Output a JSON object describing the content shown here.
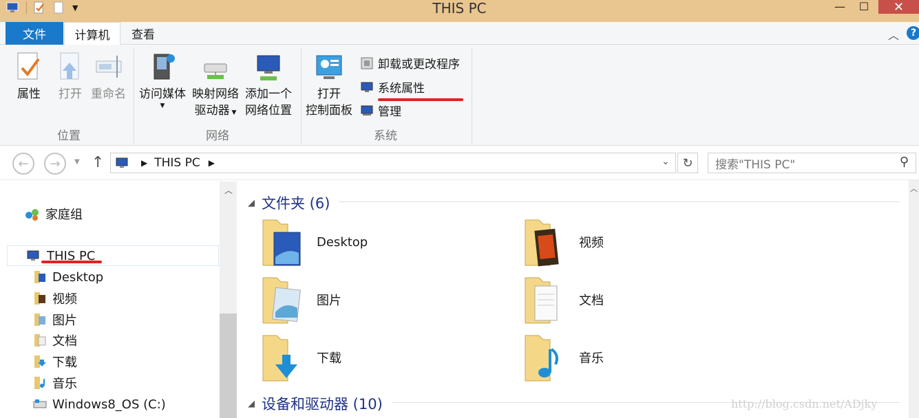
{
  "window": {
    "title": "THIS PC",
    "close_glyph": "✕",
    "maximize_glyph": "☐",
    "minimize_glyph": "—"
  },
  "tabs": [
    {
      "label": "文件"
    },
    {
      "label": "计算机"
    },
    {
      "label": "查看"
    }
  ],
  "ribbon": {
    "location": {
      "group_label": "位置",
      "properties": "属性",
      "open": "打开",
      "rename": "重命名"
    },
    "network": {
      "group_label": "网络",
      "access_media": "访问媒体",
      "map_drive_line1": "映射网络",
      "map_drive_line2": "驱动器",
      "add_location_line1": "添加一个",
      "add_location_line2": "网络位置"
    },
    "system": {
      "group_label": "系统",
      "open_cp_line1": "打开",
      "open_cp_line2": "控制面板",
      "uninstall": "卸载或更改程序",
      "system_properties": "系统属性",
      "manage": "管理"
    }
  },
  "address": {
    "path": "THIS PC",
    "search_placeholder": "搜索\"THIS PC\""
  },
  "nav": {
    "homegroup": "家庭组",
    "this_pc": "THIS PC",
    "items": [
      "Desktop",
      "视频",
      "图片",
      "文档",
      "下载",
      "音乐",
      "Windows8_OS (C:)"
    ]
  },
  "content": {
    "folders_header": "文件夹 (6)",
    "folders": [
      "Desktop",
      "视频",
      "图片",
      "文档",
      "下载",
      "音乐"
    ],
    "devices_header": "设备和驱动器 (10)"
  },
  "watermark": "http://blog.csdn.net/ADjky",
  "colors": {
    "titlebar": "#e9c58f",
    "file_tab": "#1979ca",
    "close_button": "#c7504a",
    "annotation_red": "#e8201f",
    "section_header": "#1e3287"
  }
}
